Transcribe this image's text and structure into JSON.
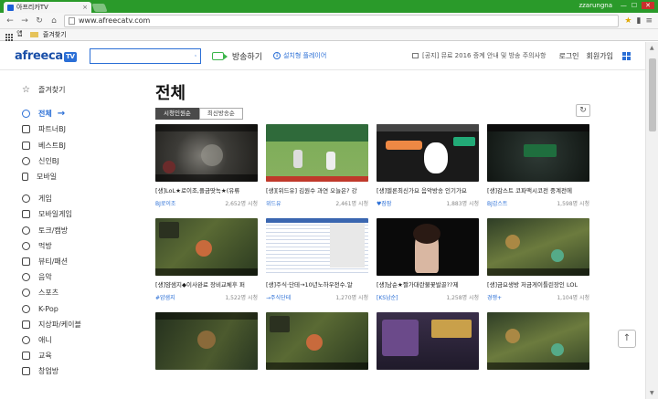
{
  "browser": {
    "tab_title": "아프리카TV",
    "profile": "zzarungna",
    "url": "www.afreecatv.com",
    "bookmarks": [
      {
        "label": "앱"
      },
      {
        "label": "즐겨찾기"
      }
    ]
  },
  "header": {
    "logo": "afreeca",
    "logo_tv": "TV",
    "search_placeholder": "",
    "broadcast_label": "방송하기",
    "install_label": "설치형 플레이어",
    "notice": "[공지] 뮤료 2016 증계 안내 및 방송 주의사항",
    "login": "로그인",
    "signup": "회원가입"
  },
  "sidebar": {
    "favorites": "즐겨찾기",
    "group1": [
      {
        "label": "전체",
        "active": true
      },
      {
        "label": "파트너BJ"
      },
      {
        "label": "베스트BJ"
      },
      {
        "label": "신인BJ"
      },
      {
        "label": "모바일"
      }
    ],
    "group2": [
      {
        "label": "게임"
      },
      {
        "label": "모바일게임"
      },
      {
        "label": "토크/캠방"
      },
      {
        "label": "먹방"
      },
      {
        "label": "뷰티/패션"
      },
      {
        "label": "음악"
      },
      {
        "label": "스포츠"
      },
      {
        "label": "K-Pop"
      },
      {
        "label": "지상파/케이블"
      },
      {
        "label": "애니"
      },
      {
        "label": "교육"
      },
      {
        "label": "창업방"
      }
    ]
  },
  "main": {
    "title": "전체",
    "sort_tabs": [
      {
        "label": "시청인원순",
        "active": true
      },
      {
        "label": "최신방송순",
        "active": false
      }
    ],
    "cards": [
      {
        "title": "[생]LoL★로이조,플금땃녹★(유류",
        "bj": "BJ로이조",
        "viewers": "2,652명 시청",
        "thumb": "t-game1"
      },
      {
        "title": "[생][위드유] 김원수 과연 오늘은? 강",
        "bj": "위드유",
        "viewers": "2,461명 시청",
        "thumb": "t-baseball"
      },
      {
        "title": "[생]멜론최신가요 음악방송 인기가요",
        "bj": "♥잠잠",
        "viewers": "1,883명 시청",
        "thumb": "t-cartoon"
      },
      {
        "title": "[생]감스트 코파맥시코전 중계전에",
        "bj": "BJ감스트",
        "viewers": "1,598명 시청",
        "thumb": "t-dark"
      },
      {
        "title": "[생]얌샘지◆이사완료 장비교체후 퍼",
        "bj": "#얌샘지",
        "viewers": "1,522명 시청",
        "thumb": "t-lol"
      },
      {
        "title": "[생]주식·단테→10년노하우전수.알",
        "bj": "→주식단테",
        "viewers": "1,270명 시청",
        "thumb": "t-sheet"
      },
      {
        "title": "[생]남순★짤가대란불꽃발골??제",
        "bj": "[KS남순]",
        "viewers": "1,258명 시청",
        "thumb": "t-cam"
      },
      {
        "title": "[생]금요생방 저금게이틀린장인 LOL",
        "bj": "경쟁+",
        "viewers": "1,104명 시청",
        "thumb": "t-lol2"
      },
      {
        "title": "",
        "bj": "",
        "viewers": "",
        "thumb": "t-lol3"
      },
      {
        "title": "",
        "bj": "",
        "viewers": "",
        "thumb": "t-lol"
      },
      {
        "title": "",
        "bj": "",
        "viewers": "",
        "thumb": "t-items"
      },
      {
        "title": "",
        "bj": "",
        "viewers": "",
        "thumb": "t-lol2"
      }
    ]
  }
}
